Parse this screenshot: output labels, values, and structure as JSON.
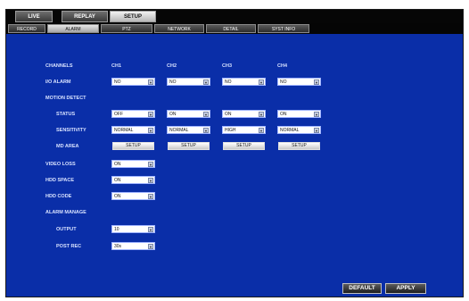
{
  "tabs": {
    "live": "LIVE",
    "replay": "REPLAY",
    "setup": "SETUP"
  },
  "subtabs": {
    "record": "RECORD",
    "alarm": "ALARM",
    "ptz": "PTZ",
    "network": "NETWORK",
    "detail": "DETAIL",
    "sysinfo": "SYST INFO"
  },
  "labels": {
    "channels": "CHANNELS",
    "io_alarm": "I/O ALARM",
    "motion_detect": "MOTION DETECT",
    "status": "STATUS",
    "sensitivity": "SENSITIVITY",
    "md_area": "MD AREA",
    "video_loss": "VIDEO LOSS",
    "hdd_space": "HDD SPACE",
    "hdd_code": "HDD CODE",
    "alarm_manage": "ALARM MANAGE",
    "output": "OUTPUT",
    "post_rec": "POST REC"
  },
  "channels": [
    "CH1",
    "CH2",
    "CH3",
    "CH4"
  ],
  "io_alarm": [
    "NO",
    "NO",
    "NO",
    "NO"
  ],
  "status": [
    "OFF",
    "ON",
    "ON",
    "ON"
  ],
  "sensitivity": [
    "NORMAL",
    "NORMAL",
    "HIGH",
    "NORMAL"
  ],
  "md_area_button": "SETUP",
  "video_loss": "ON",
  "hdd_space": "ON",
  "hdd_code": "ON",
  "output": "10",
  "post_rec": "30s",
  "buttons": {
    "default": "DEFAULT",
    "apply": "APPLY"
  },
  "dropdown_icon": "chevron-down-icon"
}
